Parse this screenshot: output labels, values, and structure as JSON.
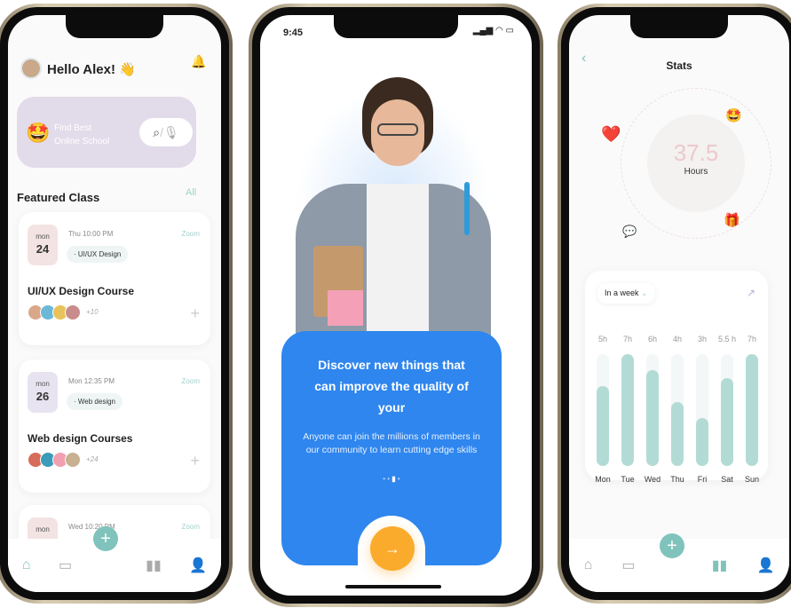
{
  "left": {
    "greeting": "Hello Alex!",
    "wave_emoji": "👋",
    "search_prompt_1": "Find Best",
    "search_prompt_2": "Online School",
    "search_separator": "/",
    "featured_title": "Featured Class",
    "all_link": "All",
    "classes": [
      {
        "day_label": "mon",
        "day": "24",
        "time": "Thu 10:00 PM",
        "tag": "· UI/UX Design",
        "platform": "Zoom",
        "title": "UI/UX Design Course",
        "more": "+10",
        "date_color": "#f3e3e3"
      },
      {
        "day_label": "mon",
        "day": "26",
        "time": "Mon 12:35 PM",
        "tag": "· Web design",
        "platform": "Zoom",
        "title": "Web design Courses",
        "more": "+24",
        "date_color": "#e8e3f0"
      },
      {
        "day_label": "mon",
        "time": "Wed 10:20 PM",
        "platform": "Zoom",
        "date_color": "#f3e3e3"
      }
    ]
  },
  "middle": {
    "status_time": "9:45",
    "headline": "Discover new things that can improve the quality of your",
    "body": "Anyone can join the millions of members in our community to learn cutting edge skills",
    "next_icon": "→",
    "accent": "#2f86ee",
    "button_color": "#fbab2c"
  },
  "right": {
    "title": "Stats",
    "hours_value": "37.5",
    "hours_label": "Hours",
    "period_select": "In a week",
    "chart_data": {
      "type": "bar",
      "categories": [
        "Mon",
        "Tue",
        "Wed",
        "Thu",
        "Fri",
        "Sat",
        "Sun"
      ],
      "values": [
        5,
        7,
        6,
        4,
        3,
        5.5,
        7
      ],
      "value_labels": [
        "5h",
        "7h",
        "6h",
        "4h",
        "3h",
        "5.5 h",
        "7h"
      ],
      "ylim": [
        0,
        7
      ],
      "bar_color": "#b3dbd6"
    }
  },
  "colors": {
    "teal": "#7fc3bc",
    "purple_banner": "#e2dbea"
  }
}
